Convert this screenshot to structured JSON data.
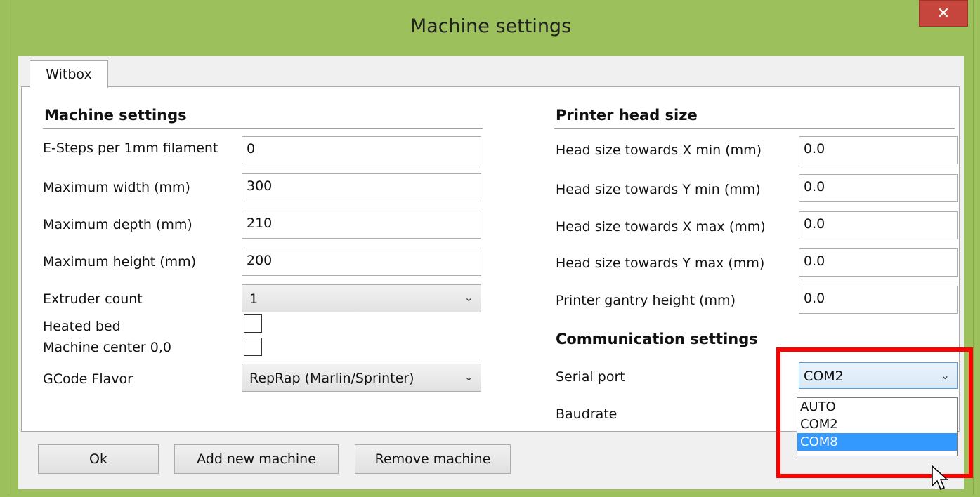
{
  "window": {
    "title": "Machine settings",
    "close_glyph": "✕"
  },
  "tabs": [
    "Witbox"
  ],
  "machine_settings": {
    "title": "Machine settings",
    "esteps_label": "E-Steps per 1mm filament",
    "esteps_value": "0",
    "width_label": "Maximum width (mm)",
    "width_value": "300",
    "depth_label": "Maximum depth (mm)",
    "depth_value": "210",
    "height_label": "Maximum height (mm)",
    "height_value": "200",
    "extruder_label": "Extruder count",
    "extruder_value": "1",
    "heated_bed_label": "Heated bed",
    "center_label": "Machine center 0,0",
    "gcode_label": "GCode Flavor",
    "gcode_value": "RepRap (Marlin/Sprinter)"
  },
  "printer_head": {
    "title": "Printer head size",
    "xmin_label": "Head size towards X min (mm)",
    "xmin_value": "0.0",
    "ymin_label": "Head size towards Y min (mm)",
    "ymin_value": "0.0",
    "xmax_label": "Head size towards X max (mm)",
    "xmax_value": "0.0",
    "ymax_label": "Head size towards Y max (mm)",
    "ymax_value": "0.0",
    "gantry_label": "Printer gantry height (mm)",
    "gantry_value": "0.0"
  },
  "communication": {
    "title": "Communication settings",
    "serial_label": "Serial port",
    "serial_value": "COM2",
    "baud_label": "Baudrate",
    "serial_options": [
      "AUTO",
      "COM2",
      "COM8"
    ]
  },
  "buttons": {
    "ok": "Ok",
    "add": "Add new machine",
    "remove": "Remove machine"
  },
  "colors": {
    "titlebar": "#9cc15c",
    "close": "#c6463d",
    "highlight": "#ff0000",
    "selection": "#3399ff"
  }
}
